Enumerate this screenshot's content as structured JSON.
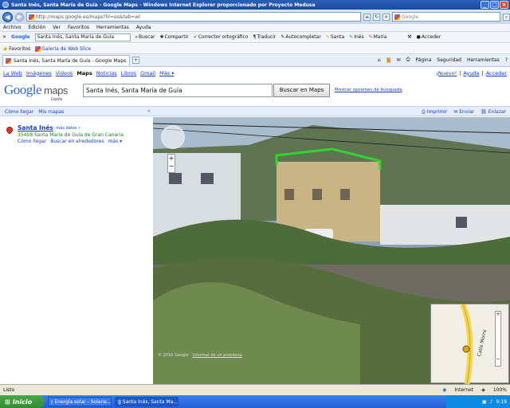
{
  "window": {
    "title": "Santa Inés, Santa María de Guía - Google Maps - Windows Internet Explorer proporcionado por Proyecto Medusa"
  },
  "address_bar": {
    "url": "http://maps.google.es/maps?hl=es&tab=wl",
    "search_placeholder": "Google"
  },
  "menu": [
    "Archivo",
    "Edición",
    "Ver",
    "Favoritos",
    "Herramientas",
    "Ayuda"
  ],
  "google_toolbar": {
    "logo": "Google",
    "query": "Santa Inés, Santa María de Guía",
    "buttons": [
      "Buscar",
      "Compartir",
      "Corrector ortográfico",
      "Traducir",
      "Autocompletar",
      "Santa",
      "Inés",
      "María",
      "Acceder"
    ]
  },
  "favorites_bar": {
    "favorites_label": "Favoritos",
    "webslice_label": "Galería de Web Slice"
  },
  "tab": {
    "title": "Santa Inés, Santa María de Guía - Google Maps"
  },
  "tab_tools": [
    "Página",
    "Seguridad",
    "Herramientas"
  ],
  "google_nav": {
    "links": [
      "La Web",
      "Imágenes",
      "Videos",
      "Maps",
      "Noticias",
      "Libros",
      "Gmail",
      "Más ▾"
    ],
    "active": "Maps",
    "right_links": [
      "¡Nuevo!",
      "Ayuda",
      "Acceder"
    ]
  },
  "header": {
    "logo_word": "Google",
    "logo_product": "maps",
    "logo_region": "España",
    "search_value": "Santa Inés, Santa María de Guía",
    "search_button": "Buscar en Maps",
    "options_link": "Mostrar opciones de búsqueda"
  },
  "subnav": {
    "links": [
      "Cómo llegar",
      "Mis mapas"
    ],
    "collapse": "«",
    "print": "Imprimir",
    "email": "Enviar",
    "link": "Enlazar"
  },
  "result": {
    "title": "Santa Inés",
    "more": "- más datos »",
    "address": "35458 Santa María de Guía de Gran Canaria",
    "links": [
      "Cómo llegar",
      "Buscar en alrededores",
      "más ▾"
    ]
  },
  "map": {
    "copyright": "© 2010 Google",
    "report": "Informar de un problema",
    "inset_street": "Calle Morra",
    "highlight_color": "#2fd42f"
  },
  "status": {
    "left": "Listo",
    "zone": "Internet",
    "zoom": "100%"
  },
  "taskbar": {
    "start": "Inicio",
    "tasks": [
      "Energía solar - Solarw...",
      "Santa Inés, Santa Ma..."
    ],
    "clock": "9:19"
  }
}
